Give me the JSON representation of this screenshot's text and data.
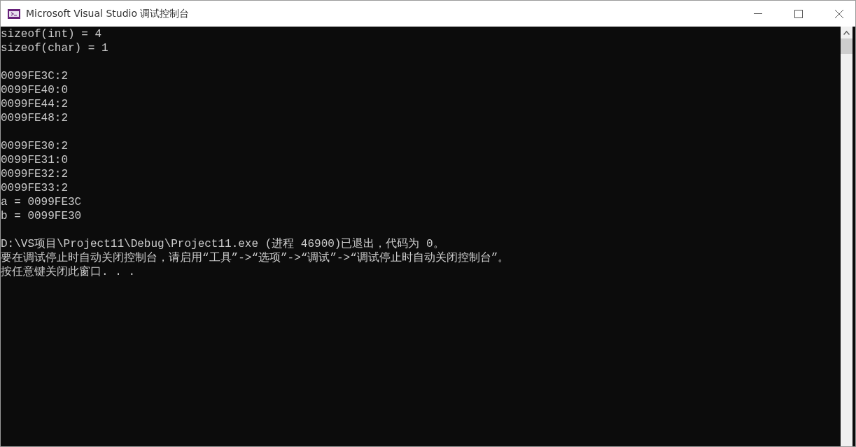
{
  "window": {
    "title": "Microsoft Visual Studio 调试控制台"
  },
  "console": {
    "blocks": [
      [
        "sizeof(int) = 4",
        "sizeof(char) = 1"
      ],
      [
        "0099FE3C:2",
        "0099FE40:0",
        "0099FE44:2",
        "0099FE48:2"
      ],
      [
        "0099FE30:2",
        "0099FE31:0",
        "0099FE32:2",
        "0099FE33:2",
        "a = 0099FE3C",
        "b = 0099FE30"
      ],
      [
        "D:\\VS项目\\Project11\\Debug\\Project11.exe (进程 46900)已退出，代码为 0。",
        "要在调试停止时自动关闭控制台，请启用“工具”->“选项”->“调试”->“调试停止时自动关闭控制台”。",
        "按任意键关闭此窗口. . ."
      ]
    ]
  }
}
